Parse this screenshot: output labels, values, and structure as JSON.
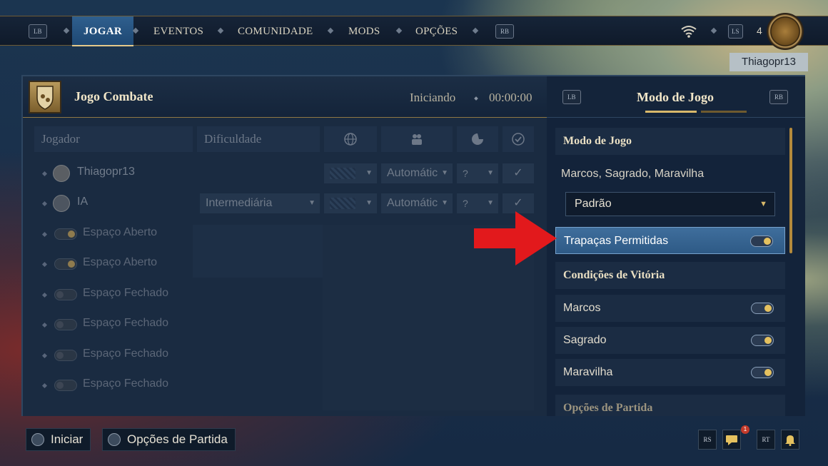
{
  "topbar": {
    "lb_label": "LB",
    "rb_label": "RB",
    "nav": [
      {
        "label": "JOGAR",
        "active": true
      },
      {
        "label": "EVENTOS",
        "active": false
      },
      {
        "label": "COMUNIDADE",
        "active": false
      },
      {
        "label": "MODS",
        "active": false
      },
      {
        "label": "OPÇÕES",
        "active": false
      }
    ],
    "ls_label": "LS",
    "count": "4",
    "username": "Thiagopr13"
  },
  "game": {
    "title": "Jogo Combate",
    "status": "Iniciando",
    "timer": "00:00:00"
  },
  "right_panel": {
    "lb_label": "LB",
    "rb_label": "RB",
    "tab_title": "Modo de Jogo"
  },
  "table": {
    "headers": {
      "player": "Jogador",
      "difficulty": "Dificuldade"
    },
    "players": [
      {
        "name": "Thiagopr13",
        "team": "Automátic"
      },
      {
        "name": "IA",
        "difficulty": "Intermediária",
        "team": "Automátic"
      }
    ],
    "slots": [
      {
        "label": "Espaço Aberto",
        "open": true
      },
      {
        "label": "Espaço Aberto",
        "open": true
      },
      {
        "label": "Espaço Fechado",
        "open": false
      },
      {
        "label": "Espaço Fechado",
        "open": false
      },
      {
        "label": "Espaço Fechado",
        "open": false
      },
      {
        "label": "Espaço Fechado",
        "open": false
      }
    ]
  },
  "settings": {
    "mode_header": "Modo de Jogo",
    "mode_summary": "Marcos, Sagrado, Maravilha",
    "mode_select": "Padrão",
    "cheats_label": "Trapaças Permitidas",
    "victory_header": "Condições de Vitória",
    "victory_options": [
      "Marcos",
      "Sagrado",
      "Maravilha"
    ],
    "next_header": "Opções de Partida"
  },
  "bottom": {
    "start_label": "Iniciar",
    "options_label": "Opções de Partida",
    "rs_label": "RS",
    "rt_label": "RT",
    "notification_count": "1"
  },
  "colors": {
    "accent_gold": "#d9b96a",
    "highlight_blue": "#3f6e9c",
    "arrow_red": "#e2191c"
  }
}
